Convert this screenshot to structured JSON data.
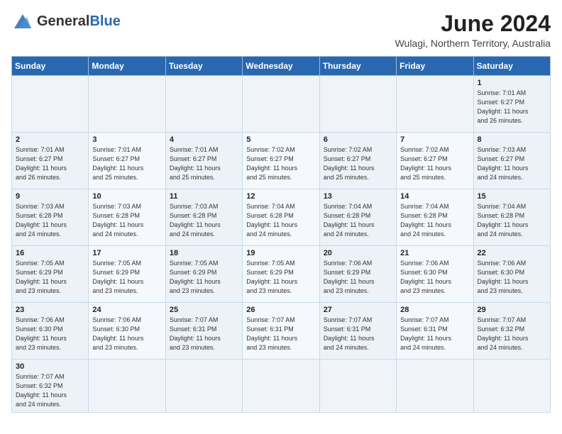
{
  "header": {
    "logo_general": "General",
    "logo_blue": "Blue",
    "month_year": "June 2024",
    "location": "Wulagi, Northern Territory, Australia"
  },
  "weekdays": [
    "Sunday",
    "Monday",
    "Tuesday",
    "Wednesday",
    "Thursday",
    "Friday",
    "Saturday"
  ],
  "weeks": [
    [
      {
        "day": "",
        "info": ""
      },
      {
        "day": "",
        "info": ""
      },
      {
        "day": "",
        "info": ""
      },
      {
        "day": "",
        "info": ""
      },
      {
        "day": "",
        "info": ""
      },
      {
        "day": "",
        "info": ""
      },
      {
        "day": "1",
        "info": "Sunrise: 7:01 AM\nSunset: 6:27 PM\nDaylight: 11 hours\nand 26 minutes."
      }
    ],
    [
      {
        "day": "2",
        "info": "Sunrise: 7:01 AM\nSunset: 6:27 PM\nDaylight: 11 hours\nand 26 minutes."
      },
      {
        "day": "3",
        "info": "Sunrise: 7:01 AM\nSunset: 6:27 PM\nDaylight: 11 hours\nand 25 minutes."
      },
      {
        "day": "4",
        "info": "Sunrise: 7:01 AM\nSunset: 6:27 PM\nDaylight: 11 hours\nand 25 minutes."
      },
      {
        "day": "5",
        "info": "Sunrise: 7:02 AM\nSunset: 6:27 PM\nDaylight: 11 hours\nand 25 minutes."
      },
      {
        "day": "6",
        "info": "Sunrise: 7:02 AM\nSunset: 6:27 PM\nDaylight: 11 hours\nand 25 minutes."
      },
      {
        "day": "7",
        "info": "Sunrise: 7:02 AM\nSunset: 6:27 PM\nDaylight: 11 hours\nand 25 minutes."
      },
      {
        "day": "8",
        "info": "Sunrise: 7:03 AM\nSunset: 6:27 PM\nDaylight: 11 hours\nand 24 minutes."
      }
    ],
    [
      {
        "day": "9",
        "info": "Sunrise: 7:03 AM\nSunset: 6:28 PM\nDaylight: 11 hours\nand 24 minutes."
      },
      {
        "day": "10",
        "info": "Sunrise: 7:03 AM\nSunset: 6:28 PM\nDaylight: 11 hours\nand 24 minutes."
      },
      {
        "day": "11",
        "info": "Sunrise: 7:03 AM\nSunset: 6:28 PM\nDaylight: 11 hours\nand 24 minutes."
      },
      {
        "day": "12",
        "info": "Sunrise: 7:04 AM\nSunset: 6:28 PM\nDaylight: 11 hours\nand 24 minutes."
      },
      {
        "day": "13",
        "info": "Sunrise: 7:04 AM\nSunset: 6:28 PM\nDaylight: 11 hours\nand 24 minutes."
      },
      {
        "day": "14",
        "info": "Sunrise: 7:04 AM\nSunset: 6:28 PM\nDaylight: 11 hours\nand 24 minutes."
      },
      {
        "day": "15",
        "info": "Sunrise: 7:04 AM\nSunset: 6:28 PM\nDaylight: 11 hours\nand 24 minutes."
      }
    ],
    [
      {
        "day": "16",
        "info": "Sunrise: 7:05 AM\nSunset: 6:29 PM\nDaylight: 11 hours\nand 23 minutes."
      },
      {
        "day": "17",
        "info": "Sunrise: 7:05 AM\nSunset: 6:29 PM\nDaylight: 11 hours\nand 23 minutes."
      },
      {
        "day": "18",
        "info": "Sunrise: 7:05 AM\nSunset: 6:29 PM\nDaylight: 11 hours\nand 23 minutes."
      },
      {
        "day": "19",
        "info": "Sunrise: 7:05 AM\nSunset: 6:29 PM\nDaylight: 11 hours\nand 23 minutes."
      },
      {
        "day": "20",
        "info": "Sunrise: 7:06 AM\nSunset: 6:29 PM\nDaylight: 11 hours\nand 23 minutes."
      },
      {
        "day": "21",
        "info": "Sunrise: 7:06 AM\nSunset: 6:30 PM\nDaylight: 11 hours\nand 23 minutes."
      },
      {
        "day": "22",
        "info": "Sunrise: 7:06 AM\nSunset: 6:30 PM\nDaylight: 11 hours\nand 23 minutes."
      }
    ],
    [
      {
        "day": "23",
        "info": "Sunrise: 7:06 AM\nSunset: 6:30 PM\nDaylight: 11 hours\nand 23 minutes."
      },
      {
        "day": "24",
        "info": "Sunrise: 7:06 AM\nSunset: 6:30 PM\nDaylight: 11 hours\nand 23 minutes."
      },
      {
        "day": "25",
        "info": "Sunrise: 7:07 AM\nSunset: 6:31 PM\nDaylight: 11 hours\nand 23 minutes."
      },
      {
        "day": "26",
        "info": "Sunrise: 7:07 AM\nSunset: 6:31 PM\nDaylight: 11 hours\nand 23 minutes."
      },
      {
        "day": "27",
        "info": "Sunrise: 7:07 AM\nSunset: 6:31 PM\nDaylight: 11 hours\nand 24 minutes."
      },
      {
        "day": "28",
        "info": "Sunrise: 7:07 AM\nSunset: 6:31 PM\nDaylight: 11 hours\nand 24 minutes."
      },
      {
        "day": "29",
        "info": "Sunrise: 7:07 AM\nSunset: 6:32 PM\nDaylight: 11 hours\nand 24 minutes."
      }
    ],
    [
      {
        "day": "30",
        "info": "Sunrise: 7:07 AM\nSunset: 6:32 PM\nDaylight: 11 hours\nand 24 minutes."
      },
      {
        "day": "",
        "info": ""
      },
      {
        "day": "",
        "info": ""
      },
      {
        "day": "",
        "info": ""
      },
      {
        "day": "",
        "info": ""
      },
      {
        "day": "",
        "info": ""
      },
      {
        "day": "",
        "info": ""
      }
    ]
  ]
}
